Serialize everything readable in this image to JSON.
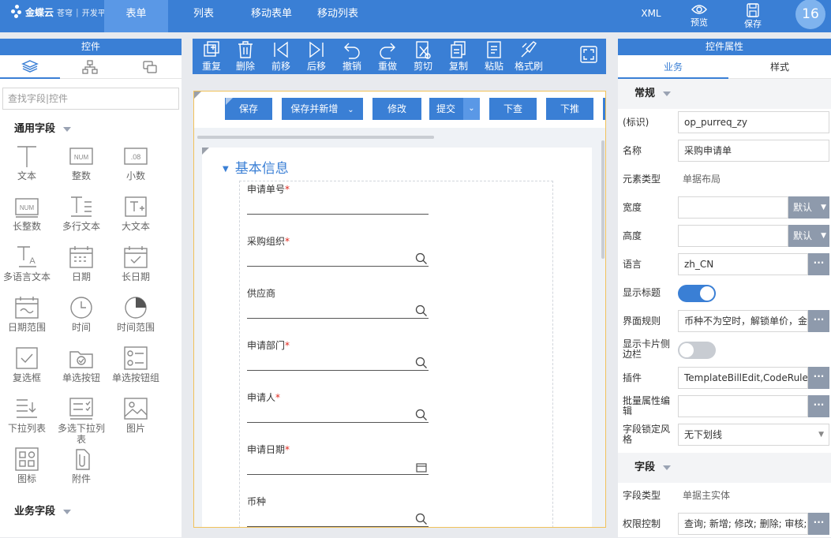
{
  "topbar": {
    "logo_brand": "金蝶云",
    "logo_sub": "苍穹",
    "logo_platform": "开发平台",
    "tabs": [
      {
        "label": "表单",
        "active": true
      },
      {
        "label": "列表",
        "active": false
      },
      {
        "label": "移动表单",
        "active": false
      },
      {
        "label": "移动列表",
        "active": false
      }
    ],
    "xml_label": "XML",
    "preview_label": "预览",
    "save_label": "保存",
    "badge": "16",
    "colors": {
      "primary": "#3a7fd5",
      "active_tab": "#5a98e6"
    }
  },
  "left_panel": {
    "title": "控件",
    "tabs": [
      "layers-icon",
      "tree-icon",
      "copy-icon"
    ],
    "search_placeholder": "查找字段|控件",
    "section_general": "通用字段",
    "section_business": "业务字段",
    "widgets": [
      {
        "label": "文本",
        "icon": "text-icon"
      },
      {
        "label": "整数",
        "icon": "num-icon"
      },
      {
        "label": "小数",
        "icon": "decimal-icon"
      },
      {
        "label": "长整数",
        "icon": "long-num-icon"
      },
      {
        "label": "多行文本",
        "icon": "multiline-icon"
      },
      {
        "label": "大文本",
        "icon": "big-text-icon"
      },
      {
        "label": "多语言文本",
        "icon": "multilang-icon"
      },
      {
        "label": "日期",
        "icon": "calendar-icon"
      },
      {
        "label": "长日期",
        "icon": "calendar-check-icon"
      },
      {
        "label": "日期范围",
        "icon": "date-range-icon"
      },
      {
        "label": "时间",
        "icon": "clock-icon"
      },
      {
        "label": "时间范围",
        "icon": "time-range-icon"
      },
      {
        "label": "复选框",
        "icon": "checkbox-icon"
      },
      {
        "label": "单选按钮",
        "icon": "radio-folder-icon"
      },
      {
        "label": "单选按钮组",
        "icon": "radio-group-icon"
      },
      {
        "label": "下拉列表",
        "icon": "dropdown-icon"
      },
      {
        "label": "多选下拉列表",
        "icon": "multi-dropdown-icon"
      },
      {
        "label": "图片",
        "icon": "image-icon"
      },
      {
        "label": "图标",
        "icon": "icon-grid-icon"
      },
      {
        "label": "附件",
        "icon": "attachment-icon"
      }
    ]
  },
  "toolbar": {
    "items": [
      {
        "label": "重复",
        "icon": "duplicate-icon"
      },
      {
        "label": "删除",
        "icon": "trash-icon"
      },
      {
        "label": "前移",
        "icon": "move-prev-icon"
      },
      {
        "label": "后移",
        "icon": "move-next-icon"
      },
      {
        "label": "撤销",
        "icon": "undo-icon"
      },
      {
        "label": "重做",
        "icon": "redo-icon"
      },
      {
        "label": "剪切",
        "icon": "cut-icon"
      },
      {
        "label": "复制",
        "icon": "copy-icon"
      },
      {
        "label": "粘贴",
        "icon": "paste-icon"
      },
      {
        "label": "格式刷",
        "icon": "format-brush-icon"
      }
    ]
  },
  "form_canvas": {
    "buttons": [
      {
        "label": "保存"
      },
      {
        "label": "保存并新增",
        "dropdown": true
      },
      {
        "label": "修改"
      },
      {
        "label": "提交",
        "dropdown": true
      },
      {
        "label": "下查"
      },
      {
        "label": "下推"
      }
    ],
    "section_title": "基本信息",
    "fields": [
      {
        "label": "申请单号",
        "required": "*",
        "suffix_icon": ""
      },
      {
        "label": "采购组织",
        "required": "*",
        "suffix_icon": "search-icon"
      },
      {
        "label": "供应商",
        "required": "",
        "suffix_icon": "search-icon"
      },
      {
        "label": "申请部门",
        "required": "*",
        "suffix_icon": "search-icon"
      },
      {
        "label": "申请人",
        "required": "*",
        "suffix_icon": "search-icon"
      },
      {
        "label": "申请日期",
        "required": "*",
        "suffix_icon": "calendar-icon"
      },
      {
        "label": "币种",
        "required": "",
        "suffix_icon": "search-icon"
      }
    ]
  },
  "right_panel": {
    "title": "控件属性",
    "tabs": [
      {
        "label": "业务",
        "active": true
      },
      {
        "label": "样式",
        "active": false
      }
    ],
    "group_general": "常规",
    "group_field": "字段",
    "props": {
      "id_label": "(标识)",
      "id_value": "op_purreq_zy",
      "name_label": "名称",
      "name_value": "采购申请单",
      "elem_type_label": "元素类型",
      "elem_type_value": "单据布局",
      "width_label": "宽度",
      "width_value": "",
      "width_unit": "默认",
      "height_label": "高度",
      "height_value": "",
      "height_unit": "默认",
      "lang_label": "语言",
      "lang_value": "zh_CN",
      "show_title_label": "显示标题",
      "show_title_on": true,
      "ui_rule_label": "界面规则",
      "ui_rule_value": "币种不为空时，解锁单价，金额",
      "card_sidebar_label": "显示卡片侧边栏",
      "card_sidebar_on": false,
      "plugin_label": "插件",
      "plugin_value": "TemplateBillEdit,CodeRule",
      "batch_label": "批量属性编辑",
      "batch_value": "",
      "lock_style_label": "字段锁定风格",
      "lock_style_value": "无下划线",
      "field_type_label": "字段类型",
      "field_type_value": "单据主实体",
      "perm_label": "权限控制",
      "perm_value": "查询; 新增; 修改; 删除; 审核;"
    },
    "more_label": "···"
  }
}
